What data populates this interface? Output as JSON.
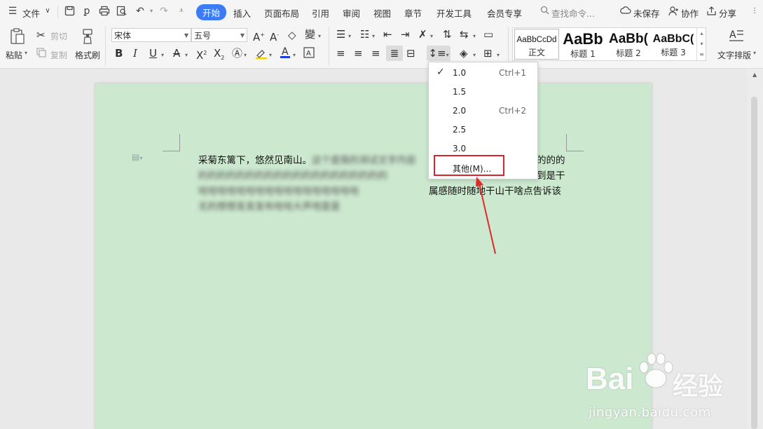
{
  "menubar": {
    "file_label": "文件",
    "tabs": [
      "开始",
      "插入",
      "页面布局",
      "引用",
      "审阅",
      "视图",
      "章节",
      "开发工具",
      "会员专享"
    ],
    "active_tab": "开始",
    "search_label": "查找命令...",
    "unsaved_label": "未保存",
    "collab_label": "协作",
    "share_label": "分享"
  },
  "ribbon": {
    "paste_label": "粘贴",
    "cut_label": "剪切",
    "copy_label": "复制",
    "format_painter_label": "格式刷",
    "font_name": "宋体",
    "font_size": "五号",
    "styles": [
      {
        "sample": "AaBbCcDd",
        "name": "正文"
      },
      {
        "sample": "AaBb",
        "name": "标题 1"
      },
      {
        "sample": "AaBb(",
        "name": "标题 2"
      },
      {
        "sample": "AaBbC(",
        "name": "标题 3"
      }
    ],
    "text_layout_label": "文字排版"
  },
  "document": {
    "line1_visible": "采菊东篱下，悠然见南山。",
    "line1_blurred": "这个是我的测试文字内容",
    "line1_tail": "的的的",
    "line2_blurred": "的的的的的的的的的的的的的的的的的的的的",
    "line2_tail": "到是干",
    "line3_blurred": "哈哈哈哈哈哈哈哈哈哈哈哈哈哈哈哈哈",
    "line3_tail": "属感随时随地干山干啥点告诉该",
    "line4_blurred": "无的想想发发发布哈哈大声地是是"
  },
  "line_spacing_menu": {
    "items": [
      {
        "value": "1.0",
        "shortcut": "Ctrl+1",
        "checked": true
      },
      {
        "value": "1.5",
        "shortcut": "",
        "checked": false
      },
      {
        "value": "2.0",
        "shortcut": "Ctrl+2",
        "checked": false
      },
      {
        "value": "2.5",
        "shortcut": "",
        "checked": false
      },
      {
        "value": "3.0",
        "shortcut": "",
        "checked": false
      }
    ],
    "other_label": "其他(M)..."
  },
  "watermark": {
    "logo_text": "Bai",
    "logo_cn": "经验",
    "url": "jingyan.baidu.com"
  },
  "colors": {
    "accent": "#3b7cf6",
    "page_bg": "#cce8cf",
    "highlight": "#d9232e"
  }
}
